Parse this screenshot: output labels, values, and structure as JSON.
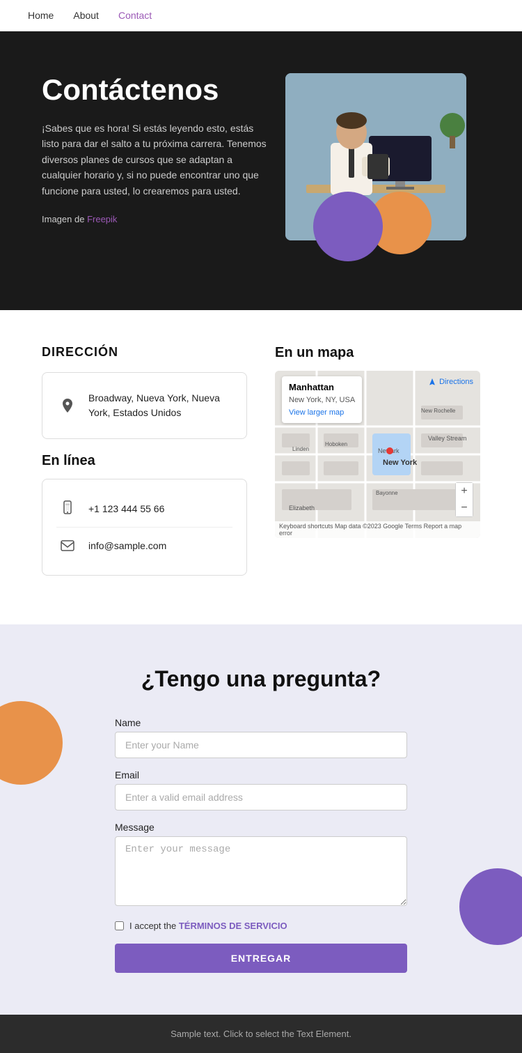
{
  "nav": {
    "items": [
      {
        "label": "Home",
        "href": "#",
        "active": false
      },
      {
        "label": "About",
        "href": "#",
        "active": false
      },
      {
        "label": "Contact",
        "href": "#",
        "active": true
      }
    ]
  },
  "hero": {
    "title": "Contáctenos",
    "description": "¡Sabes que es hora! Si estás leyendo esto, estás listo para dar el salto a tu próxima carrera. Tenemos diversos planes de cursos que se adaptan a cualquier horario y, si no puede encontrar uno que funcione para usted, lo crearemos para usted.",
    "image_credit": "Imagen de",
    "freepik_label": "Freepik",
    "freepik_url": "#"
  },
  "address_section": {
    "title": "DIRECCIÓN",
    "address": "Broadway, Nueva York, Nueva York, Estados Unidos",
    "online_title": "En línea",
    "phone": "+1 123 444 55 66",
    "email": "info@sample.com"
  },
  "map_section": {
    "title": "En un mapa",
    "place": "Manhattan",
    "region": "New York, NY, USA",
    "view_larger": "View larger map",
    "directions": "Directions",
    "zoom_in": "+",
    "zoom_out": "−",
    "footer_text": "Keyboard shortcuts  Map data ©2023 Google  Terms  Report a map error"
  },
  "form_section": {
    "title": "¿Tengo una pregunta?",
    "name_label": "Name",
    "name_placeholder": "Enter your Name",
    "email_label": "Email",
    "email_placeholder": "Enter a valid email address",
    "message_label": "Message",
    "message_placeholder": "Enter your message",
    "terms_prefix": "I accept the",
    "terms_link": "TÉRMINOS DE SERVICIO",
    "submit_label": "ENTREGAR"
  },
  "footer": {
    "text": "Sample text. Click to select the Text Element."
  }
}
